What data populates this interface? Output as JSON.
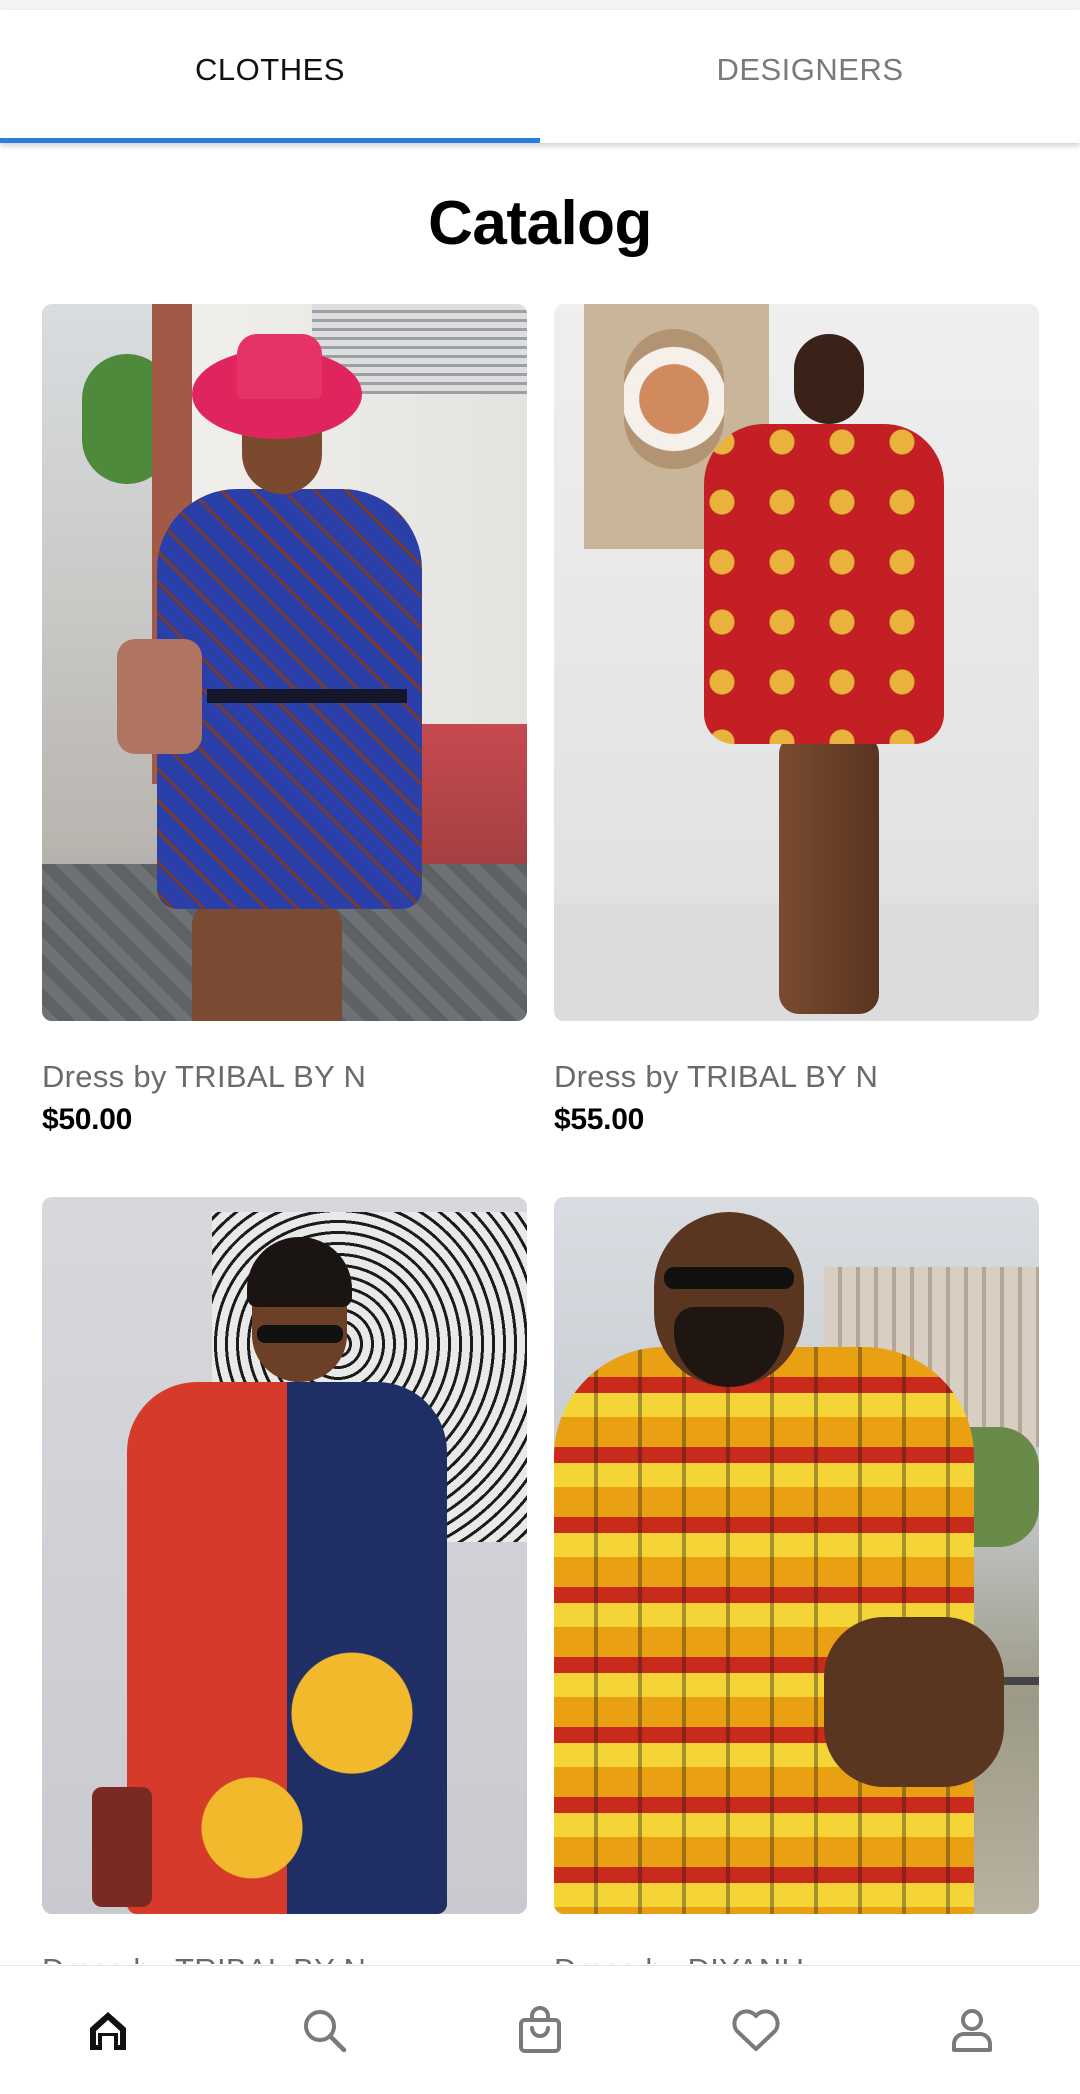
{
  "tabs": [
    {
      "label": "CLOTHES",
      "active": true
    },
    {
      "label": "DESIGNERS",
      "active": false
    }
  ],
  "accent_color": "#2a7de1",
  "page_title": "Catalog",
  "products": [
    {
      "name": "Dress by TRIBAL BY N",
      "price": "$50.00"
    },
    {
      "name": "Dress by TRIBAL BY N",
      "price": "$55.00"
    },
    {
      "name": "Dress by TRIBAL BY N",
      "price": ""
    },
    {
      "name": "Dress by DIYANU",
      "price": ""
    }
  ],
  "bottom_nav": [
    {
      "icon": "home-icon",
      "active": true
    },
    {
      "icon": "search-icon",
      "active": false
    },
    {
      "icon": "shopping-bag-icon",
      "active": false
    },
    {
      "icon": "heart-icon",
      "active": false
    },
    {
      "icon": "profile-icon",
      "active": false
    }
  ]
}
